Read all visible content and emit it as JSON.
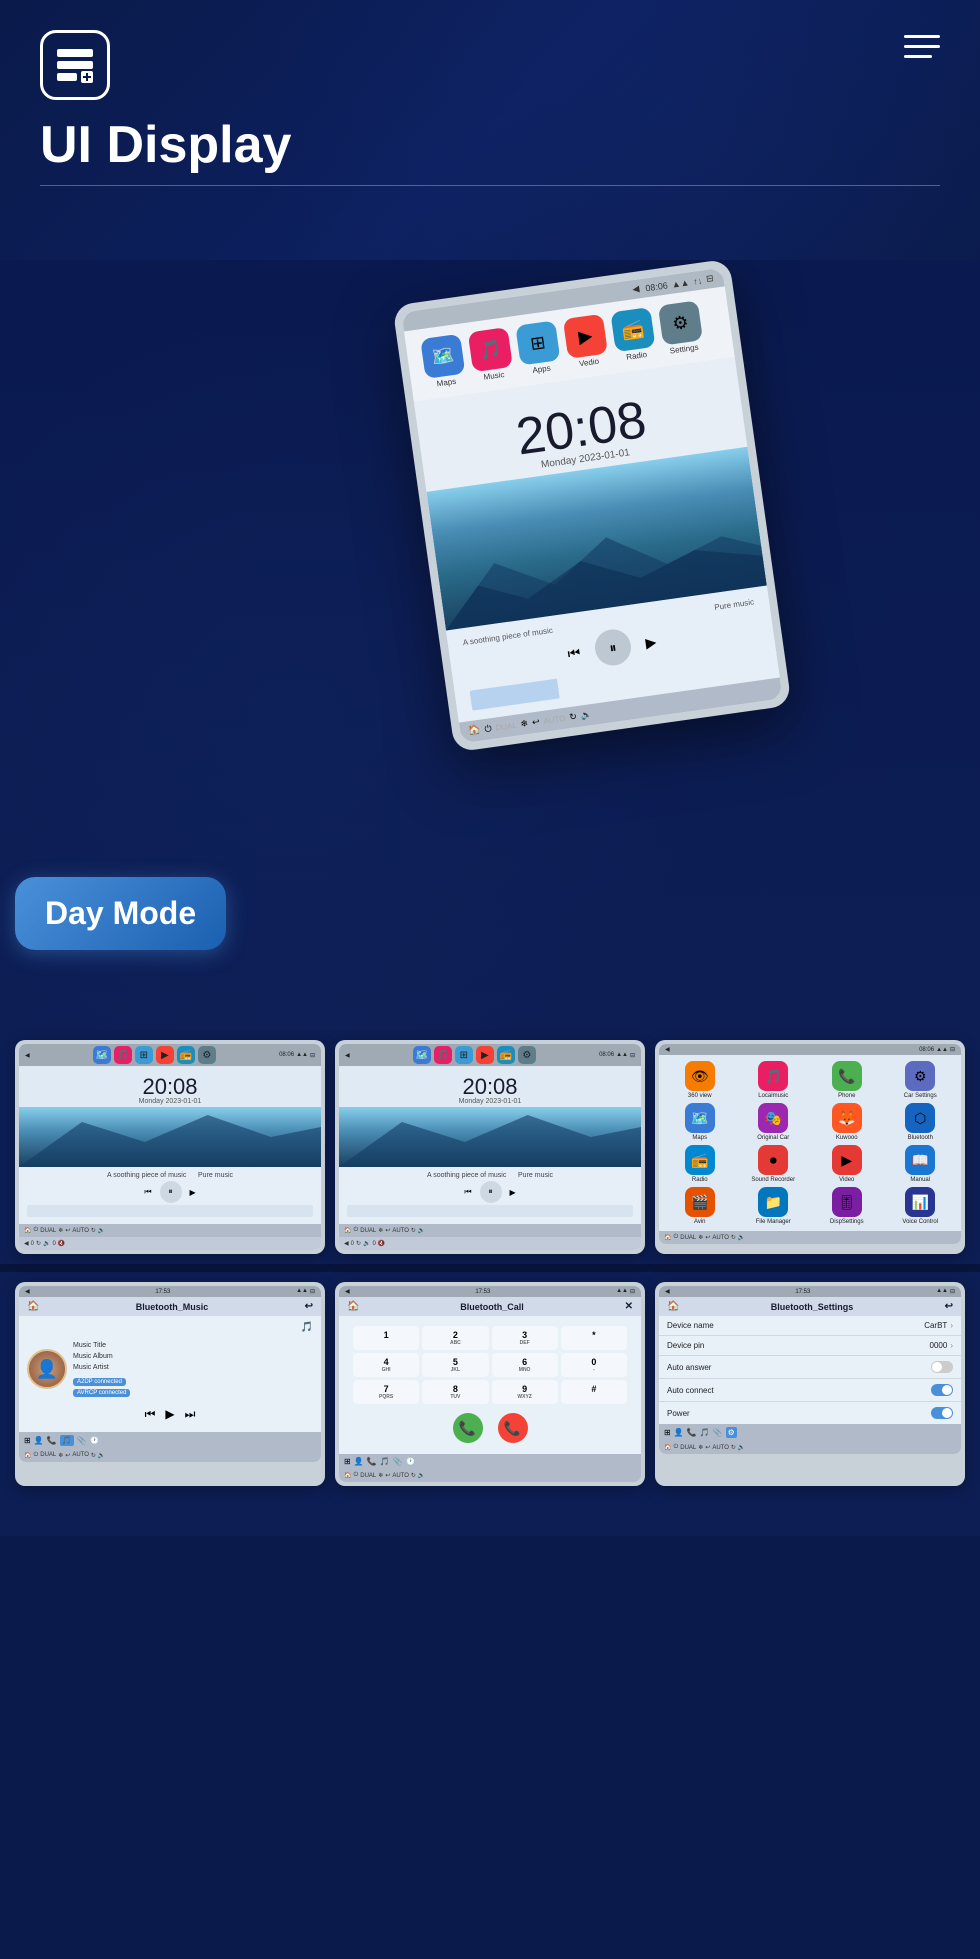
{
  "header": {
    "title": "UI Display",
    "menu_lines": [
      "",
      "",
      ""
    ],
    "logo_symbol": "☰"
  },
  "day_mode": {
    "label": "Day Mode"
  },
  "main_phone": {
    "time": "20:08",
    "date": "Monday  2023-01-01",
    "music_text": "A soothing piece of music",
    "music_right": "Pure music",
    "status_bar_time": "08:06",
    "apps": [
      {
        "label": "Maps",
        "icon": "🗺️",
        "color": "#3a7bd5"
      },
      {
        "label": "Music",
        "icon": "🎵",
        "color": "#e91e63"
      },
      {
        "label": "Apps",
        "icon": "⊞",
        "color": "#3a9bd5"
      },
      {
        "label": "Vedio",
        "icon": "▶",
        "color": "#f44336"
      },
      {
        "label": "Radio",
        "icon": "📻",
        "color": "#1a8fbf"
      },
      {
        "label": "Settings",
        "icon": "⚙",
        "color": "#607d8b"
      }
    ]
  },
  "small_phones": [
    {
      "id": "phone1",
      "time": "20:08",
      "date": "Monday  2023-01-01",
      "status_time": "08:06",
      "music_text": "A soothing piece of music",
      "music_right": "Pure music"
    },
    {
      "id": "phone2",
      "time": "20:08",
      "date": "Monday  2023-01-01",
      "status_time": "08:06",
      "music_text": "A soothing piece of music",
      "music_right": "Pure music"
    },
    {
      "id": "phone3",
      "status_time": "08:06",
      "apps": [
        {
          "label": "360 view",
          "icon": "👁",
          "color": "#f57c00"
        },
        {
          "label": "Localmusic",
          "icon": "🎵",
          "color": "#e91e63"
        },
        {
          "label": "Phone",
          "icon": "📞",
          "color": "#4CAF50"
        },
        {
          "label": "Car Settings",
          "icon": "⚙",
          "color": "#5c6bc0"
        },
        {
          "label": "Maps",
          "icon": "🗺️",
          "color": "#3a7bd5"
        },
        {
          "label": "Original Car",
          "icon": "🎭",
          "color": "#9c27b0"
        },
        {
          "label": "Kuwooo",
          "icon": "🦊",
          "color": "#ff5722"
        },
        {
          "label": "Bluetooth",
          "icon": "⬡",
          "color": "#1565c0"
        },
        {
          "label": "Radio",
          "icon": "📻",
          "color": "#0288d1"
        },
        {
          "label": "Sound Recorder",
          "icon": "⏺",
          "color": "#e53935"
        },
        {
          "label": "Video",
          "icon": "▶",
          "color": "#e53935"
        },
        {
          "label": "Manual",
          "icon": "📖",
          "color": "#1976d2"
        },
        {
          "label": "Avin",
          "icon": "🎬",
          "color": "#e65100"
        },
        {
          "label": "File Manager",
          "icon": "📁",
          "color": "#0277bd"
        },
        {
          "label": "DispSettings",
          "icon": "🎚",
          "color": "#7b1fa2"
        },
        {
          "label": "Voice Control",
          "icon": "📊",
          "color": "#283593"
        }
      ]
    }
  ],
  "bt_phones": [
    {
      "id": "bt1",
      "title": "Bluetooth_Music",
      "status_time": "17:53",
      "track": {
        "title": "Music Title",
        "album": "Music Album",
        "artist": "Music Artist",
        "badge1": "A2DP connected",
        "badge2": "AVRCP connected"
      }
    },
    {
      "id": "bt2",
      "title": "Bluetooth_Call",
      "status_time": "17:53"
    },
    {
      "id": "bt3",
      "title": "Bluetooth_Settings",
      "status_time": "17:53",
      "settings": [
        {
          "label": "Device name",
          "value": "CarBT",
          "type": "chevron"
        },
        {
          "label": "Device pin",
          "value": "0000",
          "type": "chevron"
        },
        {
          "label": "Auto answer",
          "value": "",
          "type": "toggle_off"
        },
        {
          "label": "Auto connect",
          "value": "",
          "type": "toggle_on"
        },
        {
          "label": "Power",
          "value": "",
          "type": "toggle_on"
        }
      ]
    }
  ],
  "dialpad": {
    "keys": [
      {
        "main": "1",
        "sub": ""
      },
      {
        "main": "2",
        "sub": "ABC"
      },
      {
        "main": "3",
        "sub": "DEF"
      },
      {
        "main": "*",
        "sub": ""
      },
      {
        "main": "4",
        "sub": "GHI"
      },
      {
        "main": "5",
        "sub": "JKL"
      },
      {
        "main": "6",
        "sub": "MNO"
      },
      {
        "main": "0",
        "sub": "-"
      },
      {
        "main": "7",
        "sub": "PQRS"
      },
      {
        "main": "8",
        "sub": "TUV"
      },
      {
        "main": "9",
        "sub": "WXYZ"
      },
      {
        "main": "#",
        "sub": ""
      }
    ]
  }
}
